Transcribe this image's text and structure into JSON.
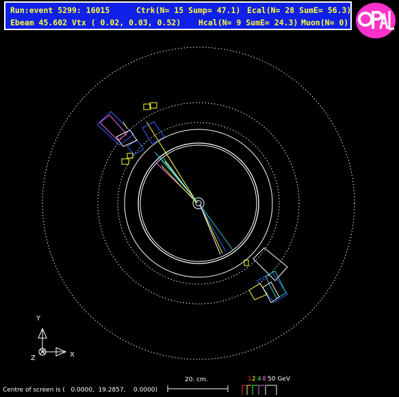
{
  "header": {
    "line1_run": "Run:event 5299: 16015",
    "line1_ctrk": "Ctrk(N= 15 Sump= 47.1)",
    "line1_ecal": "Ecal(N= 28 SumE= 56.3)",
    "line2_ebeam": "Ebeam 45.602 Vtx ( 0.02, 0.03, 0.52)",
    "line2_hcal": "Hcal(N= 9 SumE= 24.3)",
    "line2_muon": "Muon(N= 0)"
  },
  "logo": {
    "text": "OPAL",
    "icon": "opal-logo-icon"
  },
  "axes": {
    "y": "Y",
    "x": "X",
    "z": "Z"
  },
  "footer": {
    "centre_label": "Centre of screen is (",
    "centre_coords": "0.0000,  19.2857,    0.0000)"
  },
  "scale": {
    "label": "20. cm."
  },
  "energy_scale": {
    "labels": [
      "1",
      "2",
      "4",
      "8",
      "50 GeV"
    ],
    "colors": [
      "#ff3333",
      "#ffff33",
      "#33ff33",
      "#ff66ff",
      "#ffffff"
    ]
  },
  "colors": {
    "background": "#000000",
    "header_bg": "#1020e8",
    "header_text": "#ffff33",
    "detector": "#ffffff",
    "track_cyan": "#33cccc",
    "track_green": "#66ff66",
    "track_yellow": "#ffff33",
    "track_magenta": "#ff66ff",
    "track_blue": "#3366ff"
  }
}
